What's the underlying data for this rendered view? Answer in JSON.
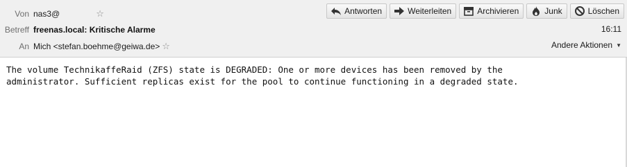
{
  "header": {
    "from_label": "Von",
    "from_value": "nas3@",
    "subject_label": "Betreff",
    "subject_value": "freenas.local: Kritische Alarme",
    "to_label": "An",
    "to_value": "Mich <stefan.boehme@geiwa.de>",
    "time": "16:11",
    "more_actions": "Andere Aktionen"
  },
  "toolbar": {
    "reply": "Antworten",
    "forward": "Weiterleiten",
    "archive": "Archivieren",
    "junk": "Junk",
    "delete": "Löschen"
  },
  "message": {
    "body": "The volume TechnikaffeRaid (ZFS) state is DEGRADED: One or more devices has been removed by the\nadministrator. Sufficient replicas exist for the pool to continue functioning in a degraded state."
  }
}
